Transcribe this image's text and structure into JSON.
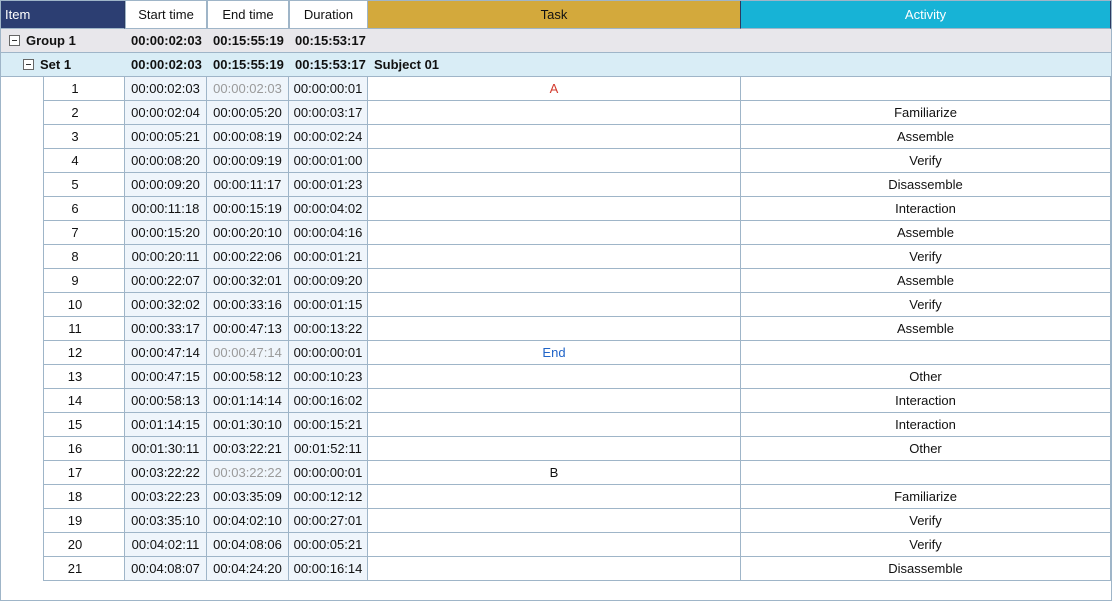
{
  "chart_data": {
    "type": "table",
    "columns": [
      "Item",
      "Start time",
      "End time",
      "Duration",
      "Task",
      "Activity"
    ],
    "group": {
      "label": "Group  1",
      "start": "00:00:02:03",
      "end": "00:15:55:19",
      "duration": "00:15:53:17"
    },
    "set": {
      "label": "Set  1",
      "start": "00:00:02:03",
      "end": "00:15:55:19",
      "duration": "00:15:53:17",
      "subject": "Subject 01"
    },
    "rows": [
      {
        "n": 1,
        "start": "00:00:02:03",
        "end": "00:00:02:03",
        "end_dim": true,
        "dur": "00:00:00:01",
        "task": "A",
        "task_style": "red",
        "activity": ""
      },
      {
        "n": 2,
        "start": "00:00:02:04",
        "end": "00:00:05:20",
        "dur": "00:00:03:17",
        "task": "",
        "activity": "Familiarize"
      },
      {
        "n": 3,
        "start": "00:00:05:21",
        "end": "00:00:08:19",
        "dur": "00:00:02:24",
        "task": "",
        "activity": "Assemble"
      },
      {
        "n": 4,
        "start": "00:00:08:20",
        "end": "00:00:09:19",
        "dur": "00:00:01:00",
        "task": "",
        "activity": "Verify"
      },
      {
        "n": 5,
        "start": "00:00:09:20",
        "end": "00:00:11:17",
        "dur": "00:00:01:23",
        "task": "",
        "activity": "Disassemble"
      },
      {
        "n": 6,
        "start": "00:00:11:18",
        "end": "00:00:15:19",
        "dur": "00:00:04:02",
        "task": "",
        "activity": "Interaction"
      },
      {
        "n": 7,
        "start": "00:00:15:20",
        "end": "00:00:20:10",
        "dur": "00:00:04:16",
        "task": "",
        "activity": "Assemble"
      },
      {
        "n": 8,
        "start": "00:00:20:11",
        "end": "00:00:22:06",
        "dur": "00:00:01:21",
        "task": "",
        "activity": "Verify"
      },
      {
        "n": 9,
        "start": "00:00:22:07",
        "end": "00:00:32:01",
        "dur": "00:00:09:20",
        "task": "",
        "activity": "Assemble"
      },
      {
        "n": 10,
        "start": "00:00:32:02",
        "end": "00:00:33:16",
        "dur": "00:00:01:15",
        "task": "",
        "activity": "Verify"
      },
      {
        "n": 11,
        "start": "00:00:33:17",
        "end": "00:00:47:13",
        "dur": "00:00:13:22",
        "task": "",
        "activity": "Assemble"
      },
      {
        "n": 12,
        "start": "00:00:47:14",
        "end": "00:00:47:14",
        "end_dim": true,
        "dur": "00:00:00:01",
        "task": "End",
        "task_style": "blue",
        "activity": ""
      },
      {
        "n": 13,
        "start": "00:00:47:15",
        "end": "00:00:58:12",
        "dur": "00:00:10:23",
        "task": "",
        "activity": "Other"
      },
      {
        "n": 14,
        "start": "00:00:58:13",
        "end": "00:01:14:14",
        "dur": "00:00:16:02",
        "task": "",
        "activity": "Interaction"
      },
      {
        "n": 15,
        "start": "00:01:14:15",
        "end": "00:01:30:10",
        "dur": "00:00:15:21",
        "task": "",
        "activity": "Interaction"
      },
      {
        "n": 16,
        "start": "00:01:30:11",
        "end": "00:03:22:21",
        "dur": "00:01:52:11",
        "task": "",
        "activity": "Other"
      },
      {
        "n": 17,
        "start": "00:03:22:22",
        "end": "00:03:22:22",
        "end_dim": true,
        "dur": "00:00:00:01",
        "task": "B",
        "task_style": "",
        "activity": ""
      },
      {
        "n": 18,
        "start": "00:03:22:23",
        "end": "00:03:35:09",
        "dur": "00:00:12:12",
        "task": "",
        "activity": "Familiarize"
      },
      {
        "n": 19,
        "start": "00:03:35:10",
        "end": "00:04:02:10",
        "dur": "00:00:27:01",
        "task": "",
        "activity": "Verify"
      },
      {
        "n": 20,
        "start": "00:04:02:11",
        "end": "00:04:08:06",
        "dur": "00:00:05:21",
        "task": "",
        "activity": "Verify"
      },
      {
        "n": 21,
        "start": "00:04:08:07",
        "end": "00:04:24:20",
        "dur": "00:00:16:14",
        "task": "",
        "activity": "Disassemble"
      }
    ]
  },
  "headers": {
    "item": "Item",
    "start": "Start time",
    "end": "End time",
    "dur": "Duration",
    "task": "Task",
    "activity": "Activity"
  }
}
